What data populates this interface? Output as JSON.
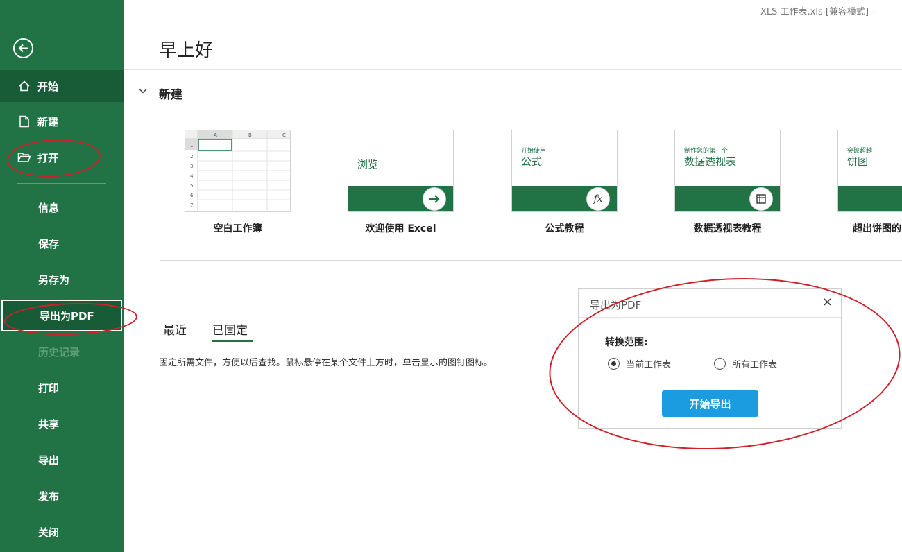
{
  "window": {
    "title": "XLS 工作表.xls  [兼容模式]  -"
  },
  "sidebar": {
    "items": [
      {
        "label": "开始",
        "icon": "home-icon"
      },
      {
        "label": "新建",
        "icon": "new-file-icon"
      },
      {
        "label": "打开",
        "icon": "folder-open-icon"
      },
      {
        "label": "信息"
      },
      {
        "label": "保存"
      },
      {
        "label": "另存为"
      },
      {
        "label": "导出为PDF"
      },
      {
        "label": "历史记录"
      },
      {
        "label": "打印"
      },
      {
        "label": "共享"
      },
      {
        "label": "导出"
      },
      {
        "label": "发布"
      },
      {
        "label": "关闭"
      }
    ]
  },
  "main": {
    "greeting": "早上好",
    "new_section": {
      "title": "新建"
    },
    "templates": [
      {
        "label": "空白工作簿"
      },
      {
        "label": "欢迎使用 Excel",
        "card_text": "浏览"
      },
      {
        "label": "公式教程",
        "card_small": "开始使用",
        "card_big": "公式"
      },
      {
        "label": "数据透视表教程",
        "card_small": "制作您的第一个",
        "card_big": "数据透视表"
      },
      {
        "label": "超出饼图的",
        "card_small": "突破超越",
        "card_big": "饼图"
      }
    ],
    "grid_columns": [
      "A",
      "B",
      "C"
    ],
    "grid_rows": [
      "1",
      "2",
      "3",
      "4",
      "5",
      "6",
      "7"
    ],
    "tabs": [
      {
        "label": "最近"
      },
      {
        "label": "已固定"
      }
    ],
    "pin_hint": "固定所需文件，方便以后查找。鼠标悬停在某个文件上方时，单击显示的图钉图标。"
  },
  "dialog": {
    "title": "导出为PDF",
    "close": "×",
    "range_label": "转换范围:",
    "options": [
      "当前工作表",
      "所有工作表"
    ],
    "selected_option": "当前工作表",
    "start_button": "开始导出"
  },
  "colors": {
    "brand_green": "#217346",
    "button_blue": "#1b9ce0",
    "annotation_red": "#d0202a"
  }
}
